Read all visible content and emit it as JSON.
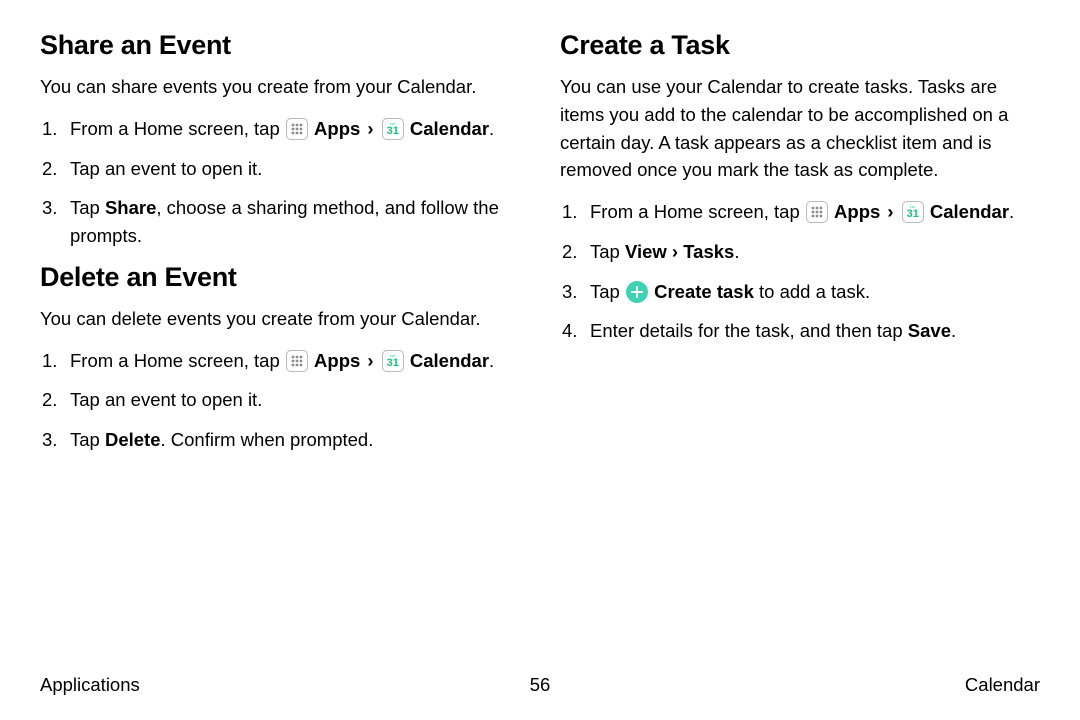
{
  "left": {
    "share": {
      "heading": "Share an Event",
      "intro": "You can share events you create from your Calendar.",
      "step1_prefix": "From a Home screen, tap ",
      "apps_label": "Apps",
      "arrow": "›",
      "calendar_label": "Calendar",
      "step1_suffix": ".",
      "step2": "Tap an event to open it.",
      "step3_pre": "Tap ",
      "step3_bold": "Share",
      "step3_post": ", choose a sharing method, and follow the prompts."
    },
    "delete": {
      "heading": "Delete an Event",
      "intro": "You can delete events you create from your Calendar.",
      "step1_prefix": "From a Home screen, tap ",
      "apps_label": "Apps",
      "arrow": "›",
      "calendar_label": "Calendar",
      "step1_suffix": ".",
      "step2": "Tap an event to open it.",
      "step3_pre": "Tap ",
      "step3_bold": "Delete",
      "step3_post": ". Confirm when prompted."
    }
  },
  "right": {
    "task": {
      "heading": "Create a Task",
      "intro": "You can use your Calendar to create tasks. Tasks are items you add to the calendar to be accomplished on a certain day. A task appears as a checklist item and is removed once you mark the task as complete.",
      "step1_prefix": "From a Home screen, tap ",
      "apps_label": "Apps",
      "arrow": "›",
      "calendar_label": "Calendar",
      "step1_suffix": ".",
      "step2_pre": "Tap ",
      "step2_bold": "View › Tasks",
      "step2_post": ".",
      "step3_pre": "Tap ",
      "step3_bold": "Create task",
      "step3_post": " to add a task.",
      "step4_pre": "Enter details for the task, and then tap ",
      "step4_bold": "Save",
      "step4_post": "."
    }
  },
  "footer": {
    "left": "Applications",
    "center": "56",
    "right": "Calendar"
  },
  "icons": {
    "cal_day": "31",
    "cal_top": "•••"
  }
}
